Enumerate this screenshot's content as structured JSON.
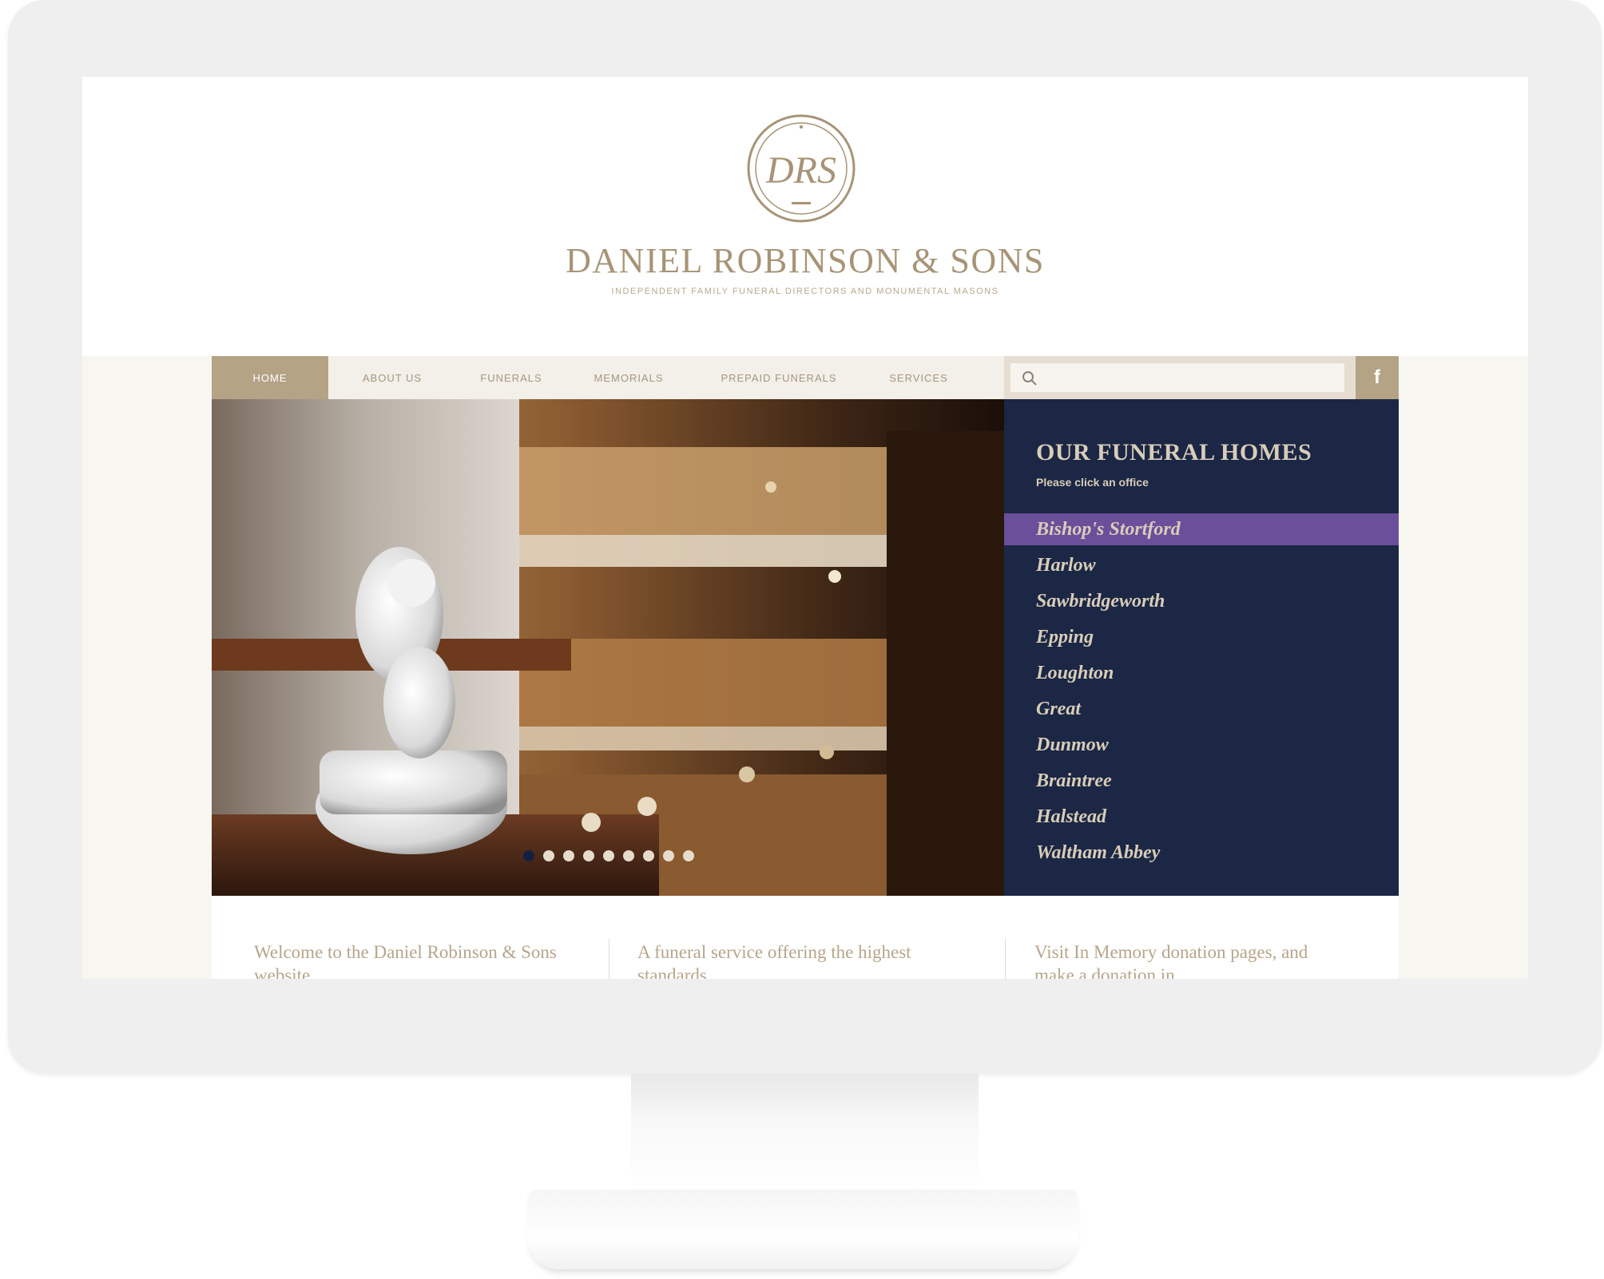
{
  "site": {
    "logo_monogram": "DRS",
    "title": "DANIEL ROBINSON & SONS",
    "tagline": "INDEPENDENT FAMILY FUNERAL DIRECTORS AND MONUMENTAL MASONS"
  },
  "nav": {
    "items": [
      {
        "label": "HOME",
        "active": true
      },
      {
        "label": "ABOUT US"
      },
      {
        "label": "FUNERALS"
      },
      {
        "label": "MEMORIALS"
      },
      {
        "label": "PREPAID FUNERALS"
      },
      {
        "label": "SERVICES"
      }
    ],
    "search_placeholder": "",
    "facebook_label": "f"
  },
  "hero": {
    "slide_count": 9,
    "active_slide": 1
  },
  "homes": {
    "title": "OUR FUNERAL HOMES",
    "subtitle": "Please click an office",
    "items": [
      {
        "label": "Bishop's Stortford",
        "active": true
      },
      {
        "label": "Harlow"
      },
      {
        "label": "Sawbridgeworth"
      },
      {
        "label": "Epping"
      },
      {
        "label": "Loughton"
      },
      {
        "label": "Great"
      },
      {
        "label": "Dunmow"
      },
      {
        "label": "Braintree"
      },
      {
        "label": "Halstead"
      },
      {
        "label": "Waltham Abbey"
      }
    ]
  },
  "intro": {
    "col1": "Welcome to the Daniel Robinson & Sons website",
    "col2": "A funeral service offering the highest standards",
    "col3": "Visit In Memory donation pages, and make a donation in"
  },
  "colors": {
    "brand_gold": "#a79477",
    "panel_navy": "#1b2745",
    "active_purple": "#6a4f9b"
  }
}
